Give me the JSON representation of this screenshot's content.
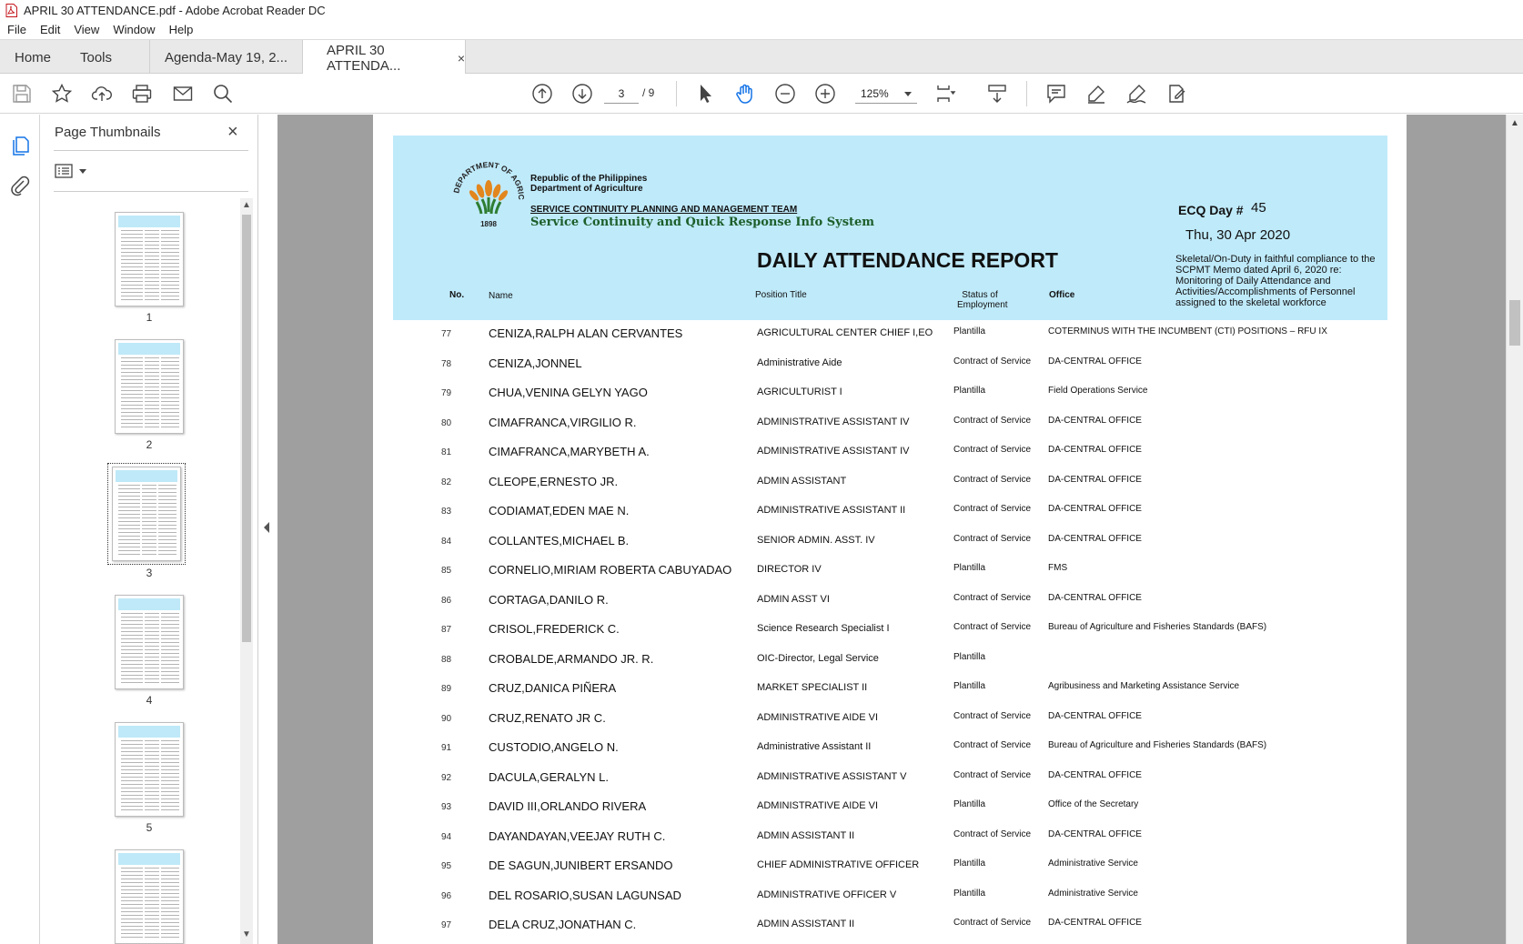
{
  "window": {
    "title": "APRIL 30 ATTENDANCE.pdf - Adobe Acrobat Reader DC"
  },
  "menu": [
    "File",
    "Edit",
    "View",
    "Window",
    "Help"
  ],
  "tabs": {
    "home": "Home",
    "tools": "Tools",
    "doc1": "Agenda-May 19, 2...",
    "doc2": "APRIL 30 ATTENDA...",
    "close": "×"
  },
  "toolbar": {
    "page_current": "3",
    "page_total": "/ 9",
    "zoom": "125%"
  },
  "thumbnails": {
    "header": "Page Thumbnails",
    "close": "×",
    "pages": [
      "1",
      "2",
      "3",
      "4",
      "5",
      ""
    ],
    "selected": 3
  },
  "document": {
    "org_line1": "Republic of the Philippines",
    "org_line2": "Department of Agriculture",
    "logo_ring": "DEPARTMENT OF AGRICULTURE",
    "logo_year": "1898",
    "team": "SERVICE CONTINUITY PLANNING AND MANAGEMENT TEAM",
    "system": "Service Continuity and Quick Response Info System",
    "report_title": "DAILY ATTENDANCE REPORT",
    "ecq_label": "ECQ Day #",
    "ecq_number": "45",
    "date": "Thu, 30 Apr 2020",
    "note": "Skeletal/On-Duty in faithful compliance to  the SCPMT Memo dated April 6, 2020 re: Monitoring of Daily Attendance and Activities/Accomplishments of Personnel assigned to the skeletal workforce",
    "columns": {
      "no": "No.",
      "name": "Name",
      "position": "Position Title",
      "status_line1": "Status of",
      "status_line2": "Employment",
      "office": "Office"
    },
    "rows": [
      {
        "no": "77",
        "name": "CENIZA,RALPH ALAN CERVANTES",
        "position": "AGRICULTURAL CENTER CHIEF I,EO",
        "status": "Plantilla",
        "office": "COTERMINUS WITH THE INCUMBENT (CTI) POSITIONS – RFU IX"
      },
      {
        "no": "78",
        "name": "CENIZA,JONNEL",
        "position": "Administrative Aide",
        "status": "Contract of Service",
        "office": "DA-CENTRAL OFFICE"
      },
      {
        "no": "79",
        "name": "CHUA,VENINA GELYN YAGO",
        "position": "AGRICULTURIST I",
        "status": "Plantilla",
        "office": "Field Operations Service"
      },
      {
        "no": "80",
        "name": "CIMAFRANCA,VIRGILIO R.",
        "position": "ADMINISTRATIVE ASSISTANT IV",
        "status": "Contract of  Service",
        "office": "DA-CENTRAL OFFICE"
      },
      {
        "no": "81",
        "name": "CIMAFRANCA,MARYBETH A.",
        "position": "ADMINISTRATIVE ASSISTANT IV",
        "status": "Contract of  Service",
        "office": "DA-CENTRAL OFFICE"
      },
      {
        "no": "82",
        "name": "CLEOPE,ERNESTO JR.",
        "position": "ADMIN ASSISTANT",
        "status": "Contract of  Service",
        "office": "DA-CENTRAL OFFICE"
      },
      {
        "no": "83",
        "name": "CODIAMAT,EDEN MAE N.",
        "position": "ADMINISTRATIVE ASSISTANT II",
        "status": "Contract of  Service",
        "office": "DA-CENTRAL OFFICE"
      },
      {
        "no": "84",
        "name": "COLLANTES,MICHAEL B.",
        "position": "SENIOR ADMIN. ASST. IV",
        "status": "Contract of  Service",
        "office": "DA-CENTRAL OFFICE"
      },
      {
        "no": "85",
        "name": "CORNELIO,MIRIAM ROBERTA CABUYADAO",
        "position": "DIRECTOR IV",
        "status": "Plantilla",
        "office": "FMS"
      },
      {
        "no": "86",
        "name": "CORTAGA,DANILO R.",
        "position": "ADMIN ASST VI",
        "status": "Contract of  Service",
        "office": "DA-CENTRAL OFFICE"
      },
      {
        "no": "87",
        "name": "CRISOL,FREDERICK C.",
        "position": "Science Research Specialist I",
        "status": "Contract of  Service",
        "office": "Bureau of Agriculture and Fisheries Standards (BAFS)"
      },
      {
        "no": "88",
        "name": "CROBALDE,ARMANDO JR. R.",
        "position": "OIC-Director, Legal Service",
        "status": "Plantilla",
        "office": ""
      },
      {
        "no": "89",
        "name": "CRUZ,DANICA PIÑERA",
        "position": "MARKET SPECIALIST II",
        "status": "Plantilla",
        "office": "Agribusiness and Marketing Assistance Service"
      },
      {
        "no": "90",
        "name": "CRUZ,RENATO JR C.",
        "position": "ADMINISTRATIVE AIDE VI",
        "status": "Contract of  Service",
        "office": "DA-CENTRAL OFFICE"
      },
      {
        "no": "91",
        "name": "CUSTODIO,ANGELO N.",
        "position": "Administrative Assistant II",
        "status": "Contract of  Service",
        "office": "Bureau of Agriculture and Fisheries Standards (BAFS)"
      },
      {
        "no": "92",
        "name": "DACULA,GERALYN L.",
        "position": "ADMINISTRATIVE ASSISTANT V",
        "status": "Contract of  Service",
        "office": "DA-CENTRAL OFFICE"
      },
      {
        "no": "93",
        "name": "DAVID III,ORLANDO RIVERA",
        "position": "ADMINISTRATIVE AIDE VI",
        "status": "Plantilla",
        "office": "Office of the Secretary"
      },
      {
        "no": "94",
        "name": "DAYANDAYAN,VEEJAY RUTH C.",
        "position": "ADMIN ASSISTANT II",
        "status": "Contract of  Service",
        "office": "DA-CENTRAL OFFICE"
      },
      {
        "no": "95",
        "name": "DE SAGUN,JUNIBERT ERSANDO",
        "position": "CHIEF ADMINISTRATIVE OFFICER",
        "status": "Plantilla",
        "office": "Administrative Service"
      },
      {
        "no": "96",
        "name": "DEL ROSARIO,SUSAN LAGUNSAD",
        "position": "ADMINISTRATIVE OFFICER V",
        "status": "Plantilla",
        "office": "Administrative Service"
      },
      {
        "no": "97",
        "name": "DELA CRUZ,JONATHAN C.",
        "position": "ADMIN ASSISTANT II",
        "status": "Contract of  Service",
        "office": "DA-CENTRAL OFFICE"
      }
    ]
  }
}
